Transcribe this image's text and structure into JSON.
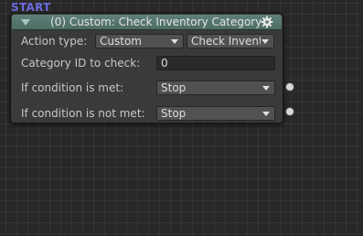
{
  "start_label": "START",
  "node": {
    "title": "(0) Custom: Check Inventory Category",
    "header_color": "#5a7a72",
    "icons": {
      "collapse": "triangle-down-icon",
      "settings": "gear-icon"
    },
    "action_type": {
      "label": "Action type:",
      "selected": "Custom",
      "secondary_selected": "Check Inventory Category"
    },
    "category_id": {
      "label": "Category ID to check:",
      "value": "0"
    },
    "condition_met": {
      "label": "If condition is met:",
      "selected": "Stop"
    },
    "condition_not_met": {
      "label": "If condition is not met:",
      "selected": "Stop"
    }
  }
}
